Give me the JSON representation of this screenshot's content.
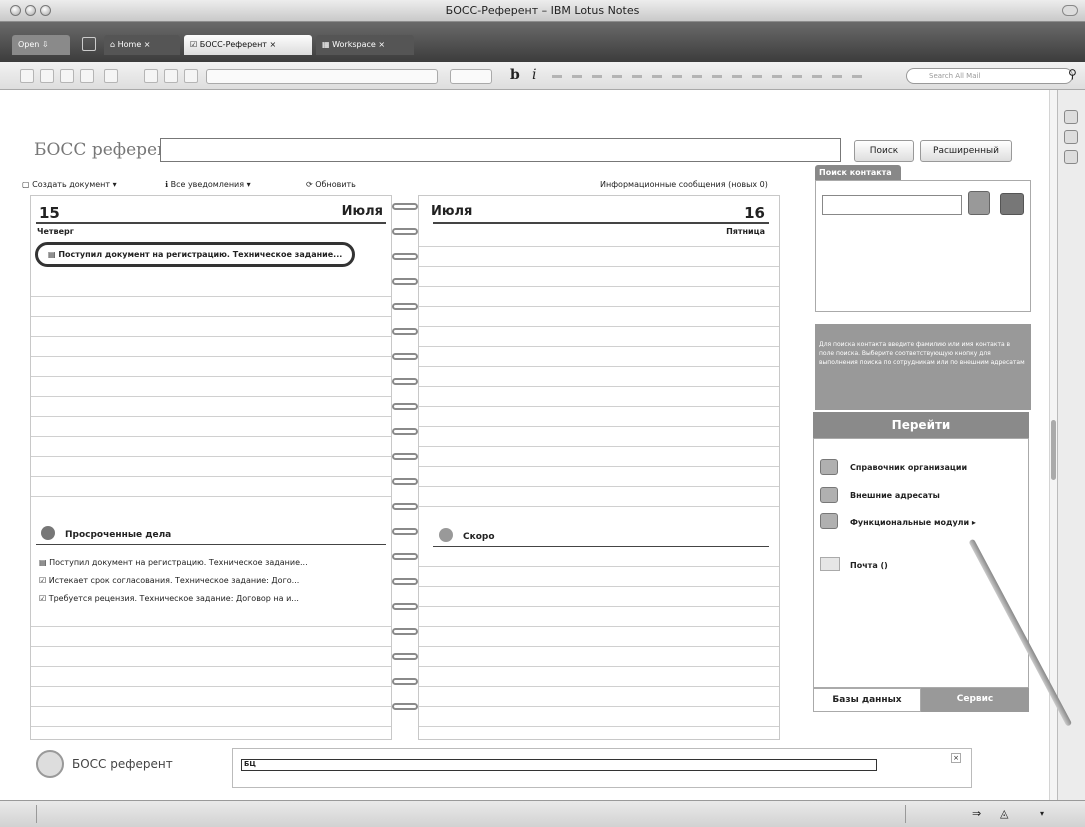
{
  "window": {
    "title": "БОСС-Референт – IBM Lotus Notes"
  },
  "tabs": [
    {
      "label": "Open ⇩"
    },
    {
      "label": "Home"
    },
    {
      "label": "БОСС-Референт"
    },
    {
      "label": "Workspace"
    }
  ],
  "toolbar": {
    "search_placeholder": "Search All Mail"
  },
  "header": {
    "logo": "БОСС референт",
    "search_btn": "Поиск",
    "advanced_btn": "Расширенный"
  },
  "actions": {
    "create": "Создать документ ▾",
    "notifications": "Все уведомления ▾",
    "refresh": "Обновить",
    "info": "Информационные сообщения (новых 0)"
  },
  "left_page": {
    "day": "15",
    "month": "Июля",
    "weekday": "Четверг",
    "items": [
      "Поступил документ на регистрацию. Техническое задание..."
    ]
  },
  "right_page": {
    "month": "Июля",
    "day": "16",
    "weekday": "Пятница"
  },
  "overdue": {
    "title": "Просроченные дела",
    "items": [
      "Поступил документ на регистрацию. Техническое задание...",
      "Истекает срок согласования. Техническое задание: Дого...",
      "Требуется рецензия. Техническое задание: Договор на и..."
    ]
  },
  "soon": {
    "title": "Скоро"
  },
  "contact": {
    "tab": "Поиск контакта",
    "hint": "Для поиска контакта введите фамилию или имя контакта в поле поиска. Выберите соответствующую кнопку для выполнения поиска по сотрудникам или по внешним адресатам"
  },
  "goto": {
    "title": "Перейти",
    "items": [
      {
        "label": "Справочник организации"
      },
      {
        "label": "Внешние адресаты"
      },
      {
        "label": "Функциональные модули ▸"
      },
      {
        "label": "Почта ()"
      }
    ],
    "tab_db": "Базы данных",
    "tab_service": "Сервис"
  },
  "footer": {
    "brand": "БОСС референт",
    "progress": "БЦ"
  },
  "colors": {
    "tabbar": "#4a4a4a",
    "accent": "#8a8a8a"
  }
}
